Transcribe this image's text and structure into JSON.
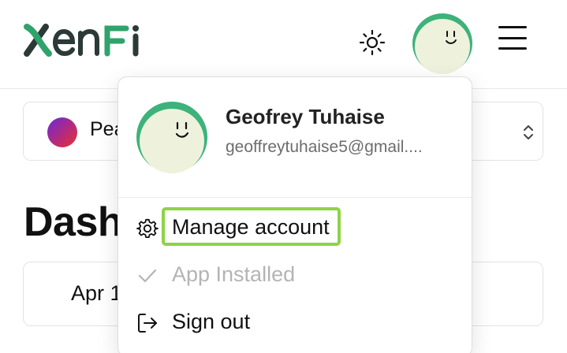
{
  "header": {
    "logo_text": "XenFi",
    "theme_toggle": "sun-icon",
    "avatar": "user-avatar",
    "menu": "hamburger-icon"
  },
  "workspace": {
    "name": "Pea",
    "icon": "workspace-gradient-dot",
    "chevron": "chevron-up-down-icon"
  },
  "page": {
    "title": "Dash",
    "date_label": "Apr 1"
  },
  "user_menu": {
    "name": "Geofrey Tuhaise",
    "email": "geoffreytuhaise5@gmail....",
    "items": [
      {
        "label": "Manage account",
        "icon": "gear-icon",
        "state": "focused"
      },
      {
        "label": "App Installed",
        "icon": "check-icon",
        "state": "disabled"
      },
      {
        "label": "Sign out",
        "icon": "sign-out-icon",
        "state": "enabled"
      }
    ]
  },
  "colors": {
    "brand_green": "#2fa36b",
    "brand_dark": "#2b3a36",
    "avatar_bg": "#eef2dc",
    "avatar_ring": "#3db27a",
    "focus_ring": "#8dd347",
    "disabled_text": "#b4b4b4"
  }
}
